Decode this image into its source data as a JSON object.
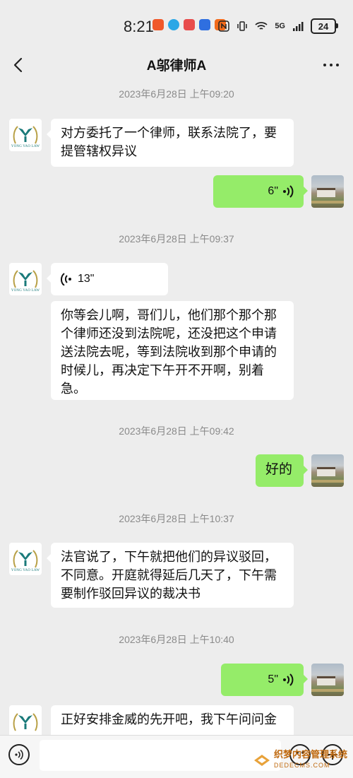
{
  "status_bar": {
    "time": "8:21",
    "network": "5G",
    "battery": "24",
    "app_icon_colors": [
      "#f0582a",
      "#2aa7e6",
      "#e84c4c",
      "#2f6fe0",
      "#f26a1b"
    ]
  },
  "header": {
    "title": "A邬律师A",
    "back_icon": "chevron-left-icon",
    "more_icon": "more-dots-icon"
  },
  "messages": [
    {
      "type": "timestamp",
      "text": "2023年6月28日 上午09:20"
    },
    {
      "type": "text",
      "side": "left",
      "text": "对方委托了一个律师，联系法院了，要提管辖权异议"
    },
    {
      "type": "voice",
      "side": "right",
      "duration": "6\""
    },
    {
      "type": "timestamp",
      "text": "2023年6月28日 上午09:37"
    },
    {
      "type": "voice",
      "side": "left",
      "duration": "13\""
    },
    {
      "type": "text",
      "side": "left",
      "text": "你等会儿啊，哥们儿，他们那个那个那个律师还没到法院呢，还没把这个申请送法院去呢，等到法院收到那个申请的时候儿，再决定下午开不开啊，别着急。"
    },
    {
      "type": "timestamp",
      "text": "2023年6月28日 上午09:42"
    },
    {
      "type": "text",
      "side": "right",
      "text": "好的"
    },
    {
      "type": "timestamp",
      "text": "2023年6月28日 上午10:37"
    },
    {
      "type": "text",
      "side": "left",
      "text": "法官说了，下午就把他们的异议驳回，不同意。开庭就得延后几天了，下午需要制作驳回异议的裁决书"
    },
    {
      "type": "timestamp",
      "text": "2023年6月28日 上午10:40"
    },
    {
      "type": "voice",
      "side": "right",
      "duration": "5\""
    },
    {
      "type": "text",
      "side": "left",
      "text": "正好安排金威的先开吧，我下午问问金"
    }
  ],
  "avatar_left": {
    "logo_text": "YONG YAO LAW",
    "color": "#1a7a7a"
  },
  "input_bar": {
    "voice_icon": "voice-toggle-icon",
    "emoji_icon": "emoji-icon",
    "plus_icon": "plus-icon"
  },
  "watermark": {
    "title": "织梦内容管理系统",
    "url": "DEDECMS.COM"
  },
  "colors": {
    "background": "#ededed",
    "bubble_left": "#ffffff",
    "bubble_right": "#95ec69",
    "timestamp": "#8a8a8a"
  }
}
